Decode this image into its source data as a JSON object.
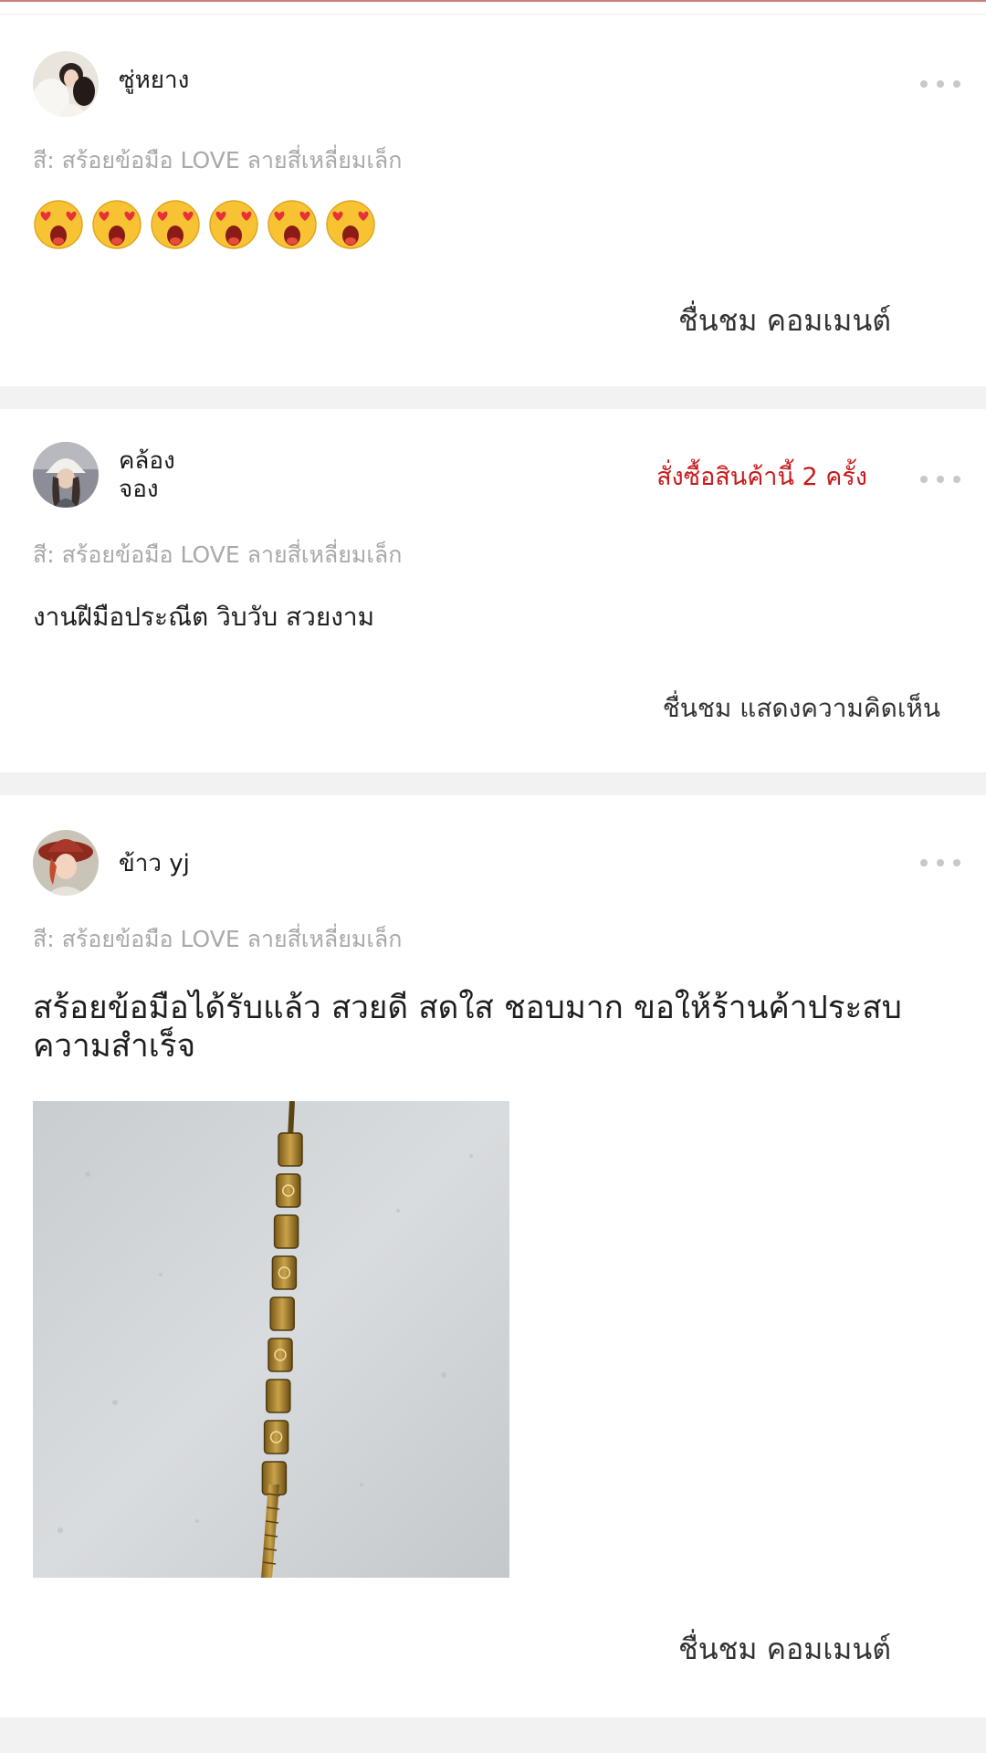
{
  "reviews": [
    {
      "username": "ซู่หยาง",
      "variant": "สี: สร้อยข้อมือ LOVE ลายสี่เหลี่ยมเล็ก",
      "emojis": [
        "heart-eyes-emoji",
        "heart-eyes-emoji",
        "heart-eyes-emoji",
        "heart-eyes-emoji",
        "heart-eyes-emoji",
        "heart-eyes-emoji"
      ],
      "footer": "ชื่นชม คอมเมนต์"
    },
    {
      "username": "คล้อง\nจอง",
      "purchase_badge": "สั่งซื้อสินค้านี้ 2 ครั้ง",
      "variant": "สี: สร้อยข้อมือ LOVE ลายสี่เหลี่ยมเล็ก",
      "text": "งานฝีมือประณีต วิบวับ สวยงาม",
      "footer": "ชื่นชม แสดงความคิดเห็น"
    },
    {
      "username": "ข้าว yj",
      "variant": "สี: สร้อยข้อมือ LOVE ลายสี่เหลี่ยมเล็ก",
      "text": "สร้อยข้อมือได้รับแล้ว สวยดี สดใส ชอบมาก ขอให้ร้านค้าประสบความสำเร็จ",
      "photo": "gold-bracelet-photo",
      "footer": "ชื่นชม คอมเมนต์"
    }
  ],
  "colors": {
    "purchase_badge": "#c8191b",
    "variant_text": "#a9a9a9",
    "divider": "#f2f2f2",
    "top_line": "#c9807a"
  },
  "icons": {
    "more": "more-dots-icon"
  }
}
